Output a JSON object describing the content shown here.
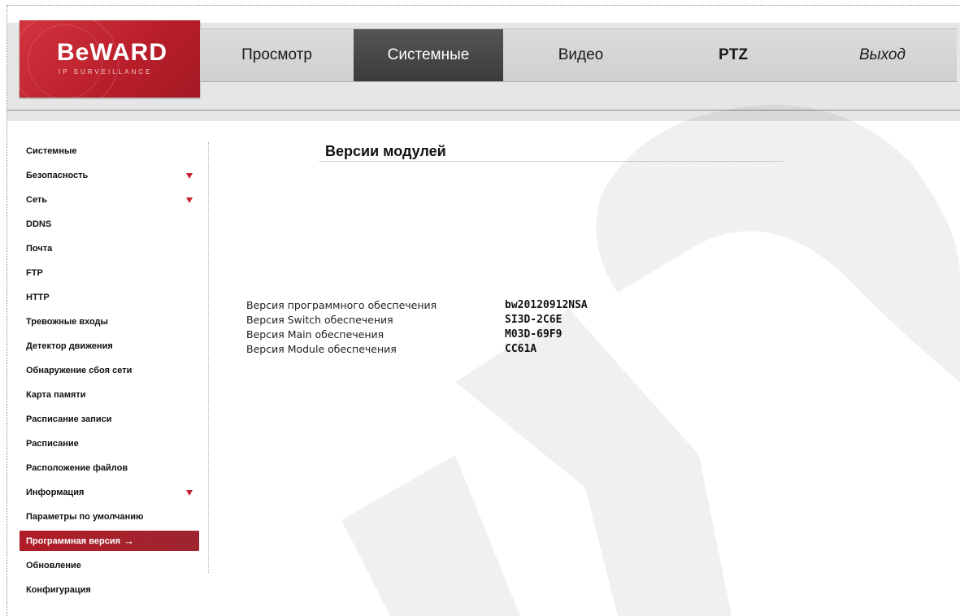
{
  "logo": {
    "word": "BeWARD",
    "sub": "IP SURVEILLANCE"
  },
  "nav": {
    "tabs": [
      {
        "label": "Просмотр"
      },
      {
        "label": "Системные"
      },
      {
        "label": "Видео"
      },
      {
        "label": "PTZ"
      },
      {
        "label": "Выход"
      }
    ],
    "active": "Системные"
  },
  "sidebar": {
    "items": [
      {
        "label": "Системные"
      },
      {
        "label": "Безопасность",
        "expandable": true
      },
      {
        "label": "Сеть",
        "expandable": true
      },
      {
        "label": "DDNS"
      },
      {
        "label": "Почта"
      },
      {
        "label": "FTP"
      },
      {
        "label": "HTTP"
      },
      {
        "label": "Тревожные входы"
      },
      {
        "label": "Детектор движения"
      },
      {
        "label": "Обнаружение сбоя сети"
      },
      {
        "label": "Карта памяти"
      },
      {
        "label": "Расписание записи"
      },
      {
        "label": "Расписание"
      },
      {
        "label": "Расположение файлов"
      },
      {
        "label": "Информация",
        "expandable": true
      },
      {
        "label": "Параметры по умолчанию"
      },
      {
        "label": "Программная версия",
        "active": true
      },
      {
        "label": "Обновление"
      },
      {
        "label": "Конфигурация"
      }
    ],
    "active_arrow": "→"
  },
  "main": {
    "title": "Версии модулей",
    "versions": [
      {
        "label": "Версия программного обеспечения",
        "value": "bw20120912NSA"
      },
      {
        "label": "Версия Switch обеспечения",
        "value": "SI3D-2C6E"
      },
      {
        "label": "Версия Main обеспечения",
        "value": "M03D-69F9"
      },
      {
        "label": "Версия Module обеспечения",
        "value": "CC61A"
      }
    ]
  },
  "colors": {
    "accent": "#b01d28",
    "nav_active": "#444444",
    "header_bg": "#e6e6e6"
  }
}
